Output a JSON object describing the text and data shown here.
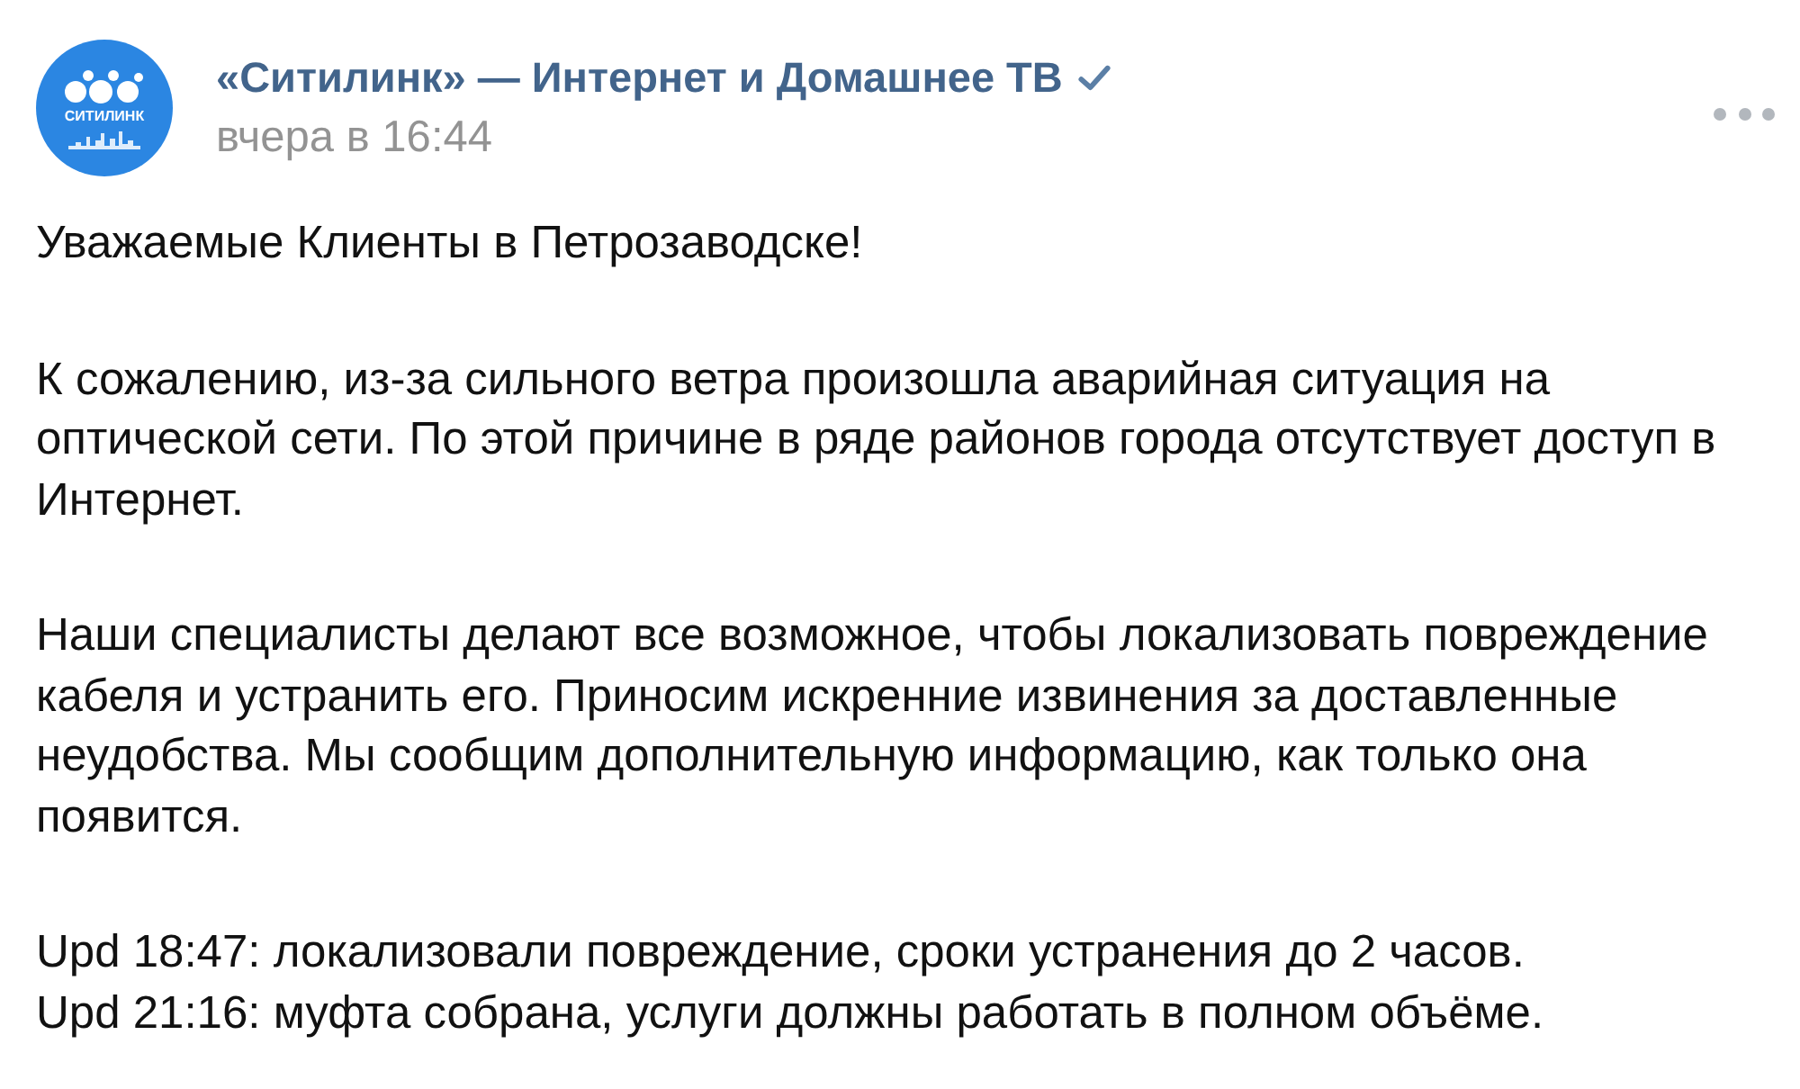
{
  "post": {
    "author": {
      "avatar_text": "СИТИЛИНК",
      "name": "«Ситилинк» — Интернет и Домашнее ТВ",
      "verified": true
    },
    "time": "вчера в 16:44",
    "paragraphs": [
      "Уважаемые Клиенты в Петрозаводске!",
      "К сожалению, из-за сильного ветра произошла аварийная ситуация на оптической сети. По этой причине в ряде районов города отсутствует доступ в Интернет.",
      "Наши специалисты делают все возможное, чтобы локализовать повреждение кабеля и устранить его. Приносим искренние извинения за доставленные неудобства. Мы сообщим дополнительную информацию, как только она появится."
    ],
    "updates": [
      "Upd 18:47: локализовали повреждение, сроки устранения до 2 часов.",
      "Upd 21:16: муфта собрана, услуги должны работать в полном объёме."
    ]
  }
}
